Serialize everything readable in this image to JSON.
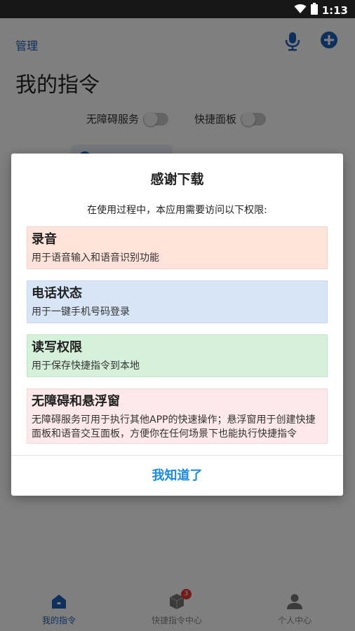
{
  "status_bar": {
    "time": "1:13"
  },
  "header": {
    "manage_label": "管理",
    "title": "我的指令"
  },
  "toggles": [
    {
      "label": "无障碍服务",
      "on": false
    },
    {
      "label": "快捷面板",
      "on": false
    }
  ],
  "bottom_nav": {
    "items": [
      {
        "label": "我的指令",
        "active": true
      },
      {
        "label": "快捷指令中心",
        "active": false,
        "badge": "3"
      },
      {
        "label": "个人中心",
        "active": false
      }
    ]
  },
  "dialog": {
    "title": "感谢下载",
    "subtitle": "在使用过程中，本应用需要访问以下权限:",
    "permissions": [
      {
        "title": "录音",
        "desc": "用于语音输入和语音识别功能",
        "color": "#fde3da"
      },
      {
        "title": "电话状态",
        "desc": "用于一键手机号码登录",
        "color": "#d7e5f6"
      },
      {
        "title": "读写权限",
        "desc": "用于保存快捷指令到本地",
        "color": "#d6f1da"
      },
      {
        "title": "无障碍和悬浮窗",
        "desc": "无障碍服务可用于执行其他APP的快速操作；悬浮窗用于创建快捷面板和语音交互面板，方便你在任何场景下也能执行快捷指令",
        "color": "#fde9ec"
      }
    ],
    "confirm_label": "我知道了"
  },
  "colors": {
    "accent": "#1f5fb8",
    "confirm": "#1a8be0",
    "badge": "#e53935"
  }
}
